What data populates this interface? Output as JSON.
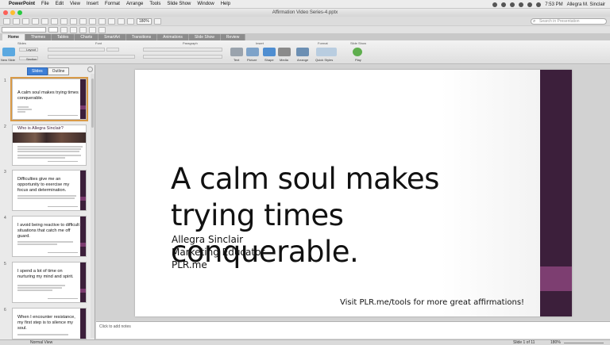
{
  "menubar": {
    "items": [
      "PowerPoint",
      "File",
      "Edit",
      "View",
      "Insert",
      "Format",
      "Arrange",
      "Tools",
      "Slide Show",
      "Window",
      "Help"
    ],
    "clock": "7:53 PM",
    "user": "Allegra M. Sinclair"
  },
  "window": {
    "title": "Affirmation Video Series-4.pptx"
  },
  "toolbar": {
    "zoom": "180%",
    "search_placeholder": "Search in Presentation"
  },
  "ribbon": {
    "tabs": [
      "Home",
      "Themes",
      "Tables",
      "Charts",
      "SmartArt",
      "Transitions",
      "Animations",
      "Slide Show",
      "Review"
    ],
    "active_tab": "Home",
    "groups": [
      "Slides",
      "Font",
      "Paragraph",
      "Insert",
      "Format",
      "Slide Show"
    ],
    "buttons": [
      "New Slide",
      "Layout",
      "Section",
      "Text",
      "Picture",
      "Shape",
      "Media",
      "Arrange",
      "Quick Styles",
      "Play"
    ]
  },
  "pane": {
    "tabs": [
      "Slides",
      "Outline"
    ],
    "slides": [
      {
        "num": "1",
        "title": "A calm soul makes trying times conquerable."
      },
      {
        "num": "2",
        "title": "Who is Allegra Sinclair?"
      },
      {
        "num": "3",
        "title": "Difficulties give me an opportunity to exercise my focus and determination."
      },
      {
        "num": "4",
        "title": "I avoid being reactive to difficult situations that catch me off guard."
      },
      {
        "num": "5",
        "title": "I spend a lot of time on nurturing my mind and spirit."
      },
      {
        "num": "6",
        "title": "When I encounter resistance, my first step is to silence my soul."
      }
    ]
  },
  "slide": {
    "title": "A calm soul makes trying times conquerable.",
    "subtitle_lines": [
      "Allegra Sinclair",
      "Marketing Educator",
      "PLR.me"
    ],
    "footer": "Visit PLR.me/tools for more great affirmations!",
    "accent_dark": "#3c1f3b",
    "accent_light": "#7d3e71"
  },
  "notes": {
    "placeholder": "Click to add notes"
  },
  "status": {
    "view": "Normal View",
    "slide_count": "Slide 1 of 11",
    "zoom": "180%"
  }
}
